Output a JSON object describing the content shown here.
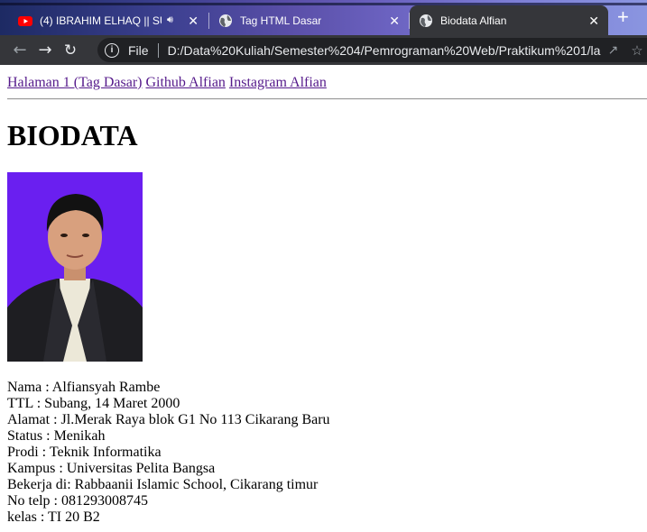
{
  "browser": {
    "tabs": [
      {
        "title": "(4) IBRAHIM ELHAQ || SU",
        "favicon": "youtube-icon",
        "audio": true
      },
      {
        "title": "Tag HTML Dasar",
        "favicon": "globe-icon"
      },
      {
        "title": "Biodata Alfian",
        "favicon": "globe-icon",
        "active": true
      }
    ],
    "new_tab": "+",
    "close_glyph": "✕",
    "address": {
      "scheme": "File",
      "url": "D:/Data%20Kuliah/Semester%204/Pemrograman%20Web/Praktikum%201/la..."
    }
  },
  "nav": {
    "links": [
      "Halaman 1 (Tag Dasar)",
      "Github Alfian",
      "Instagram Alfian"
    ]
  },
  "heading": "BIODATA",
  "bio": [
    "Nama : Alfiansyah Rambe",
    "TTL : Subang, 14 Maret 2000",
    "Alamat : Jl.Merak Raya blok G1 No 113 Cikarang Baru",
    "Status : Menikah",
    "Prodi : Teknik Informatika",
    "Kampus : Universitas Pelita Bangsa",
    "Bekerja di: Rabbaanii Islamic School, Cikarang timur",
    "No telp : 081293008745",
    "kelas : TI 20 B2"
  ],
  "colors": {
    "chrome_dark": "#35363a",
    "omnibox": "#202124",
    "visited_link": "#551a8b",
    "photo_bg": "#6a1ff0"
  }
}
